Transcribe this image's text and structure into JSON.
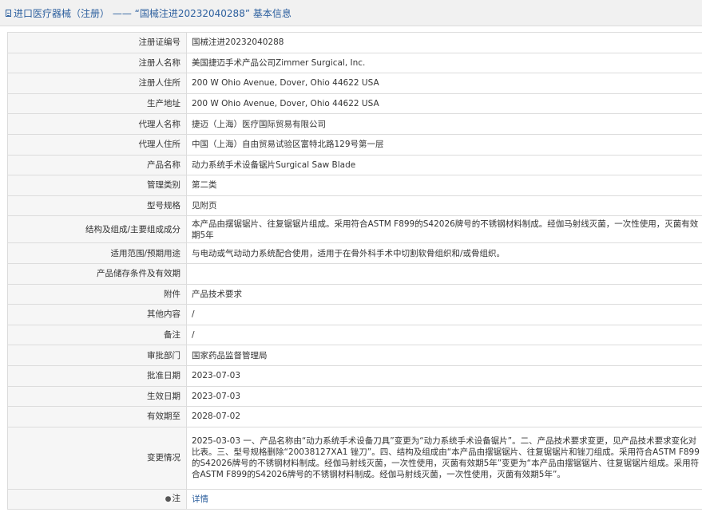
{
  "header": {
    "icon": "document-icon",
    "title": "进口医疗器械（注册） —— “国械注进20232040288” 基本信息"
  },
  "rows": [
    {
      "key": "reg_no",
      "label": "注册证编号",
      "value": "国械注进20232040288"
    },
    {
      "key": "registrant",
      "label": "注册人名称",
      "value": "美国捷迈手术产品公司Zimmer Surgical, Inc."
    },
    {
      "key": "registrant_address",
      "label": "注册人住所",
      "value": "200 W Ohio Avenue, Dover, Ohio 44622 USA"
    },
    {
      "key": "manufacture_address",
      "label": "生产地址",
      "value": "200 W Ohio Avenue, Dover, Ohio 44622 USA"
    },
    {
      "key": "agent",
      "label": "代理人名称",
      "value": "捷迈（上海）医疗国际贸易有限公司"
    },
    {
      "key": "agent_address",
      "label": "代理人住所",
      "value": "中国（上海）自由贸易试验区富特北路129号第一层"
    },
    {
      "key": "product_name",
      "label": "产品名称",
      "value": "动力系统手术设备锯片Surgical Saw Blade"
    },
    {
      "key": "category",
      "label": "管理类别",
      "value": "第二类"
    },
    {
      "key": "model",
      "label": "型号规格",
      "value": "见附页"
    },
    {
      "key": "composition",
      "label": "结构及组成/主要组成成分",
      "value": "本产品由摆锯锯片、往复锯锯片组成。采用符合ASTM F899的S42026牌号的不锈钢材料制成。经伽马射线灭菌，一次性使用，灭菌有效期5年"
    },
    {
      "key": "scope",
      "label": "适用范围/预期用途",
      "value": "与电动或气动动力系统配合使用，适用于在骨外科手术中切割软骨组织和/或骨组织。"
    },
    {
      "key": "storage",
      "label": "产品储存条件及有效期",
      "value": ""
    },
    {
      "key": "attachment",
      "label": "附件",
      "value": "产品技术要求"
    },
    {
      "key": "other",
      "label": "其他内容",
      "value": "/"
    },
    {
      "key": "remark",
      "label": "备注",
      "value": "/"
    },
    {
      "key": "approval_dept",
      "label": "审批部门",
      "value": "国家药品监督管理局"
    },
    {
      "key": "approval_date",
      "label": "批准日期",
      "value": "2023-07-03"
    },
    {
      "key": "effective_date",
      "label": "生效日期",
      "value": "2023-07-03"
    },
    {
      "key": "valid_until",
      "label": "有效期至",
      "value": "2028-07-02"
    },
    {
      "key": "changes",
      "label": "变更情况",
      "value": "2025-03-03 一、产品名称由“动力系统手术设备刀具”变更为“动力系统手术设备锯片”。二、产品技术要求变更，见产品技术要求变化对比表。三、型号规格删除“20038127XA1 锉刀”。四、结构及组成由“本产品由摆锯锯片、往复锯锯片和锉刀组成。采用符合ASTM F899的S42026牌号的不锈钢材料制成。经伽马射线灭菌，一次性使用，灭菌有效期5年”变更为“本产品由摆锯锯片、往复锯锯片组成。采用符合ASTM F899的S42026牌号的不锈钢材料制成。经伽马射线灭菌，一次性使用，灭菌有效期5年”。"
    }
  ],
  "note": {
    "label": "注",
    "icon": "pin-icon",
    "link_text": "详情"
  }
}
